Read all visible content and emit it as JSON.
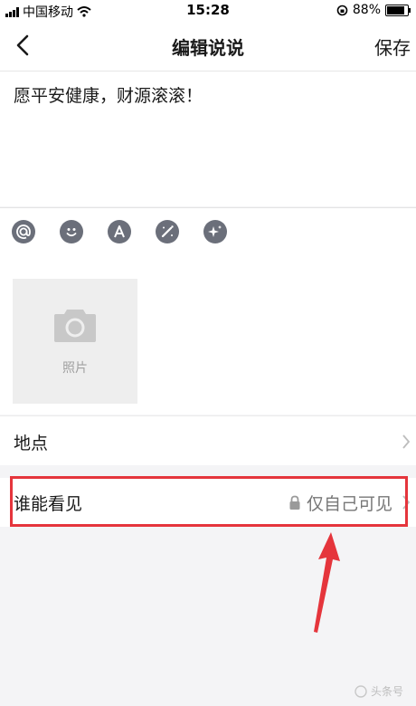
{
  "status_bar": {
    "carrier": "中国移动",
    "time": "15:28",
    "battery": "88%",
    "battery_level": 0.88
  },
  "nav": {
    "title": "编辑说说",
    "save_label": "保存"
  },
  "post": {
    "text": "愿平安健康，财源滚滚！"
  },
  "toolbar": {
    "icons": [
      "at-icon",
      "emoji-icon",
      "font-icon",
      "magic-wand-icon",
      "sparkle-icon"
    ]
  },
  "media": {
    "photo_label": "照片"
  },
  "location": {
    "label": "地点"
  },
  "visibility": {
    "label": "谁能看见",
    "value": "仅自己可见"
  },
  "colors": {
    "highlight": "#e5353c",
    "icon_gray": "#6b6f7a"
  },
  "watermark": {
    "text": "头条号"
  }
}
